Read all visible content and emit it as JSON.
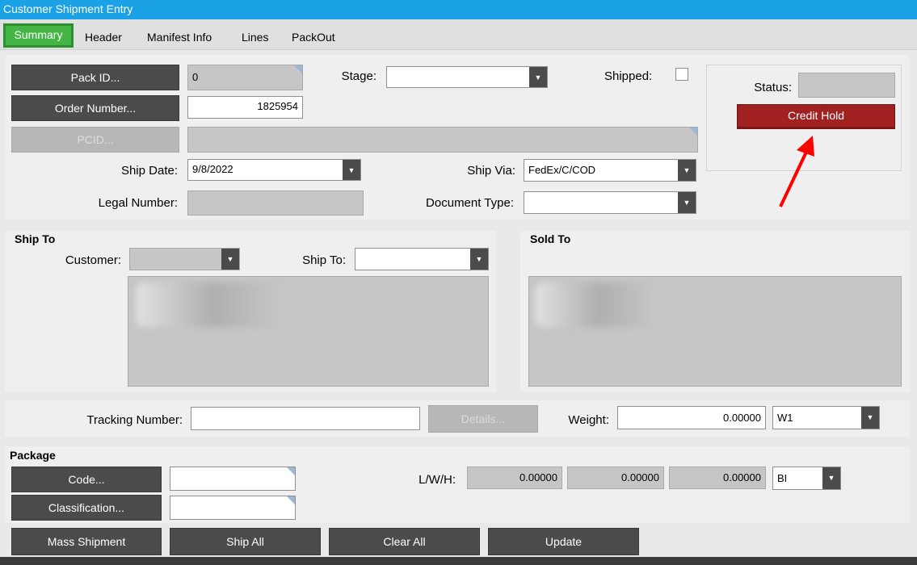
{
  "window": {
    "title": "Customer Shipment Entry"
  },
  "tabs": [
    {
      "label": "Summary",
      "active": true
    },
    {
      "label": "Header"
    },
    {
      "label": "Manifest Info"
    },
    {
      "label": "Lines"
    },
    {
      "label": "PackOut"
    }
  ],
  "summary": {
    "pack_id_button": "Pack ID...",
    "pack_id_value": "0",
    "order_number_button": "Order Number...",
    "order_number_value": "1825954",
    "pcid_button": "PCID...",
    "pcid_value": "",
    "stage_label": "Stage:",
    "stage_value": "",
    "shipped_label": "Shipped:",
    "shipped_checked": false,
    "status_label": "Status:",
    "status_value": "",
    "credit_hold_button": "Credit Hold",
    "ship_date_label": "Ship Date:",
    "ship_date_value": "9/8/2022",
    "ship_via_label": "Ship Via:",
    "ship_via_value": "FedEx/C/COD",
    "legal_number_label": "Legal Number:",
    "legal_number_value": "",
    "document_type_label": "Document Type:",
    "document_type_value": ""
  },
  "ship_to": {
    "section_title": "Ship To",
    "customer_label": "Customer:",
    "ship_to_label": "Ship To:",
    "ship_to_value": ""
  },
  "sold_to": {
    "section_title": "Sold To"
  },
  "tracking": {
    "tracking_label": "Tracking Number:",
    "tracking_value": "",
    "details_button": "Details...",
    "weight_label": "Weight:",
    "weight_value": "0.00000",
    "weight_unit": "W1"
  },
  "package": {
    "section_title": "Package",
    "code_button": "Code...",
    "code_value": "",
    "classification_button": "Classification...",
    "classification_value": "",
    "lwh_label": "L/W/H:",
    "length": "0.00000",
    "width": "0.00000",
    "height": "0.00000",
    "dim_unit": "BI"
  },
  "actions": {
    "mass_shipment": "Mass Shipment",
    "ship_all": "Ship All",
    "clear_all": "Clear All",
    "update": "Update"
  },
  "colors": {
    "titlebar": "#1aa1e6",
    "active_tab": "#45b645",
    "credit_hold": "#a12020",
    "annotation_arrow": "#ff0000"
  }
}
